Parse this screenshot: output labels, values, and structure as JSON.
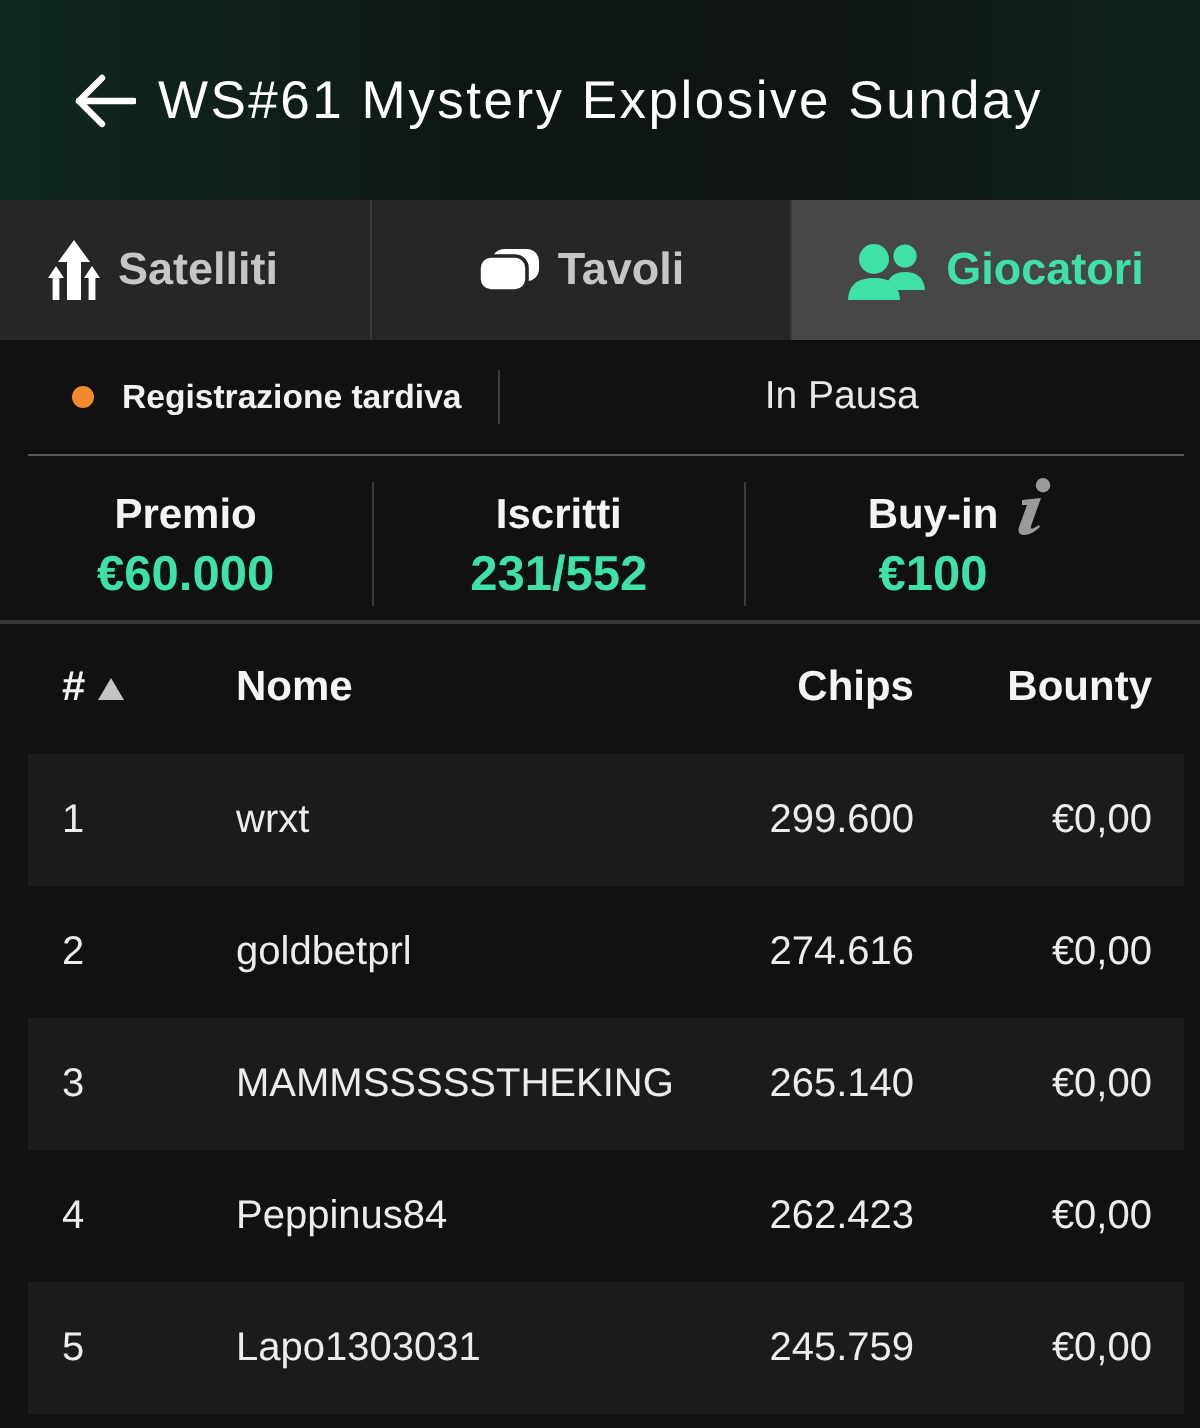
{
  "header": {
    "title": "WS#61 Mystery Explosive Sunday"
  },
  "tabs": [
    {
      "label": "Satelliti",
      "selected": false
    },
    {
      "label": "Tavoli",
      "selected": false
    },
    {
      "label": "Giocatori",
      "selected": true
    }
  ],
  "status": {
    "label": "Registrazione tardiva",
    "color": "#f08a2c",
    "state": "In Pausa"
  },
  "stats": [
    {
      "label": "Premio",
      "value": "€60.000",
      "info": false
    },
    {
      "label": "Iscritti",
      "value": "231/552",
      "info": false
    },
    {
      "label": "Buy-in",
      "value": "€100",
      "info": true
    }
  ],
  "table": {
    "columns": [
      {
        "label": "#",
        "sorted": true
      },
      {
        "label": "Nome",
        "sorted": false
      },
      {
        "label": "Chips",
        "sorted": false
      },
      {
        "label": "Bounty",
        "sorted": false
      }
    ],
    "rows": [
      {
        "rank": "1",
        "name": "wrxt",
        "chips": "299.600",
        "bounty": "€0,00"
      },
      {
        "rank": "2",
        "name": "goldbetprl",
        "chips": "274.616",
        "bounty": "€0,00"
      },
      {
        "rank": "3",
        "name": "MAMMSSSSSTHEKING",
        "chips": "265.140",
        "bounty": "€0,00"
      },
      {
        "rank": "4",
        "name": "Peppinus84",
        "chips": "262.423",
        "bounty": "€0,00"
      },
      {
        "rank": "5",
        "name": "Lapo1303031",
        "chips": "245.759",
        "bounty": "€0,00"
      }
    ]
  }
}
